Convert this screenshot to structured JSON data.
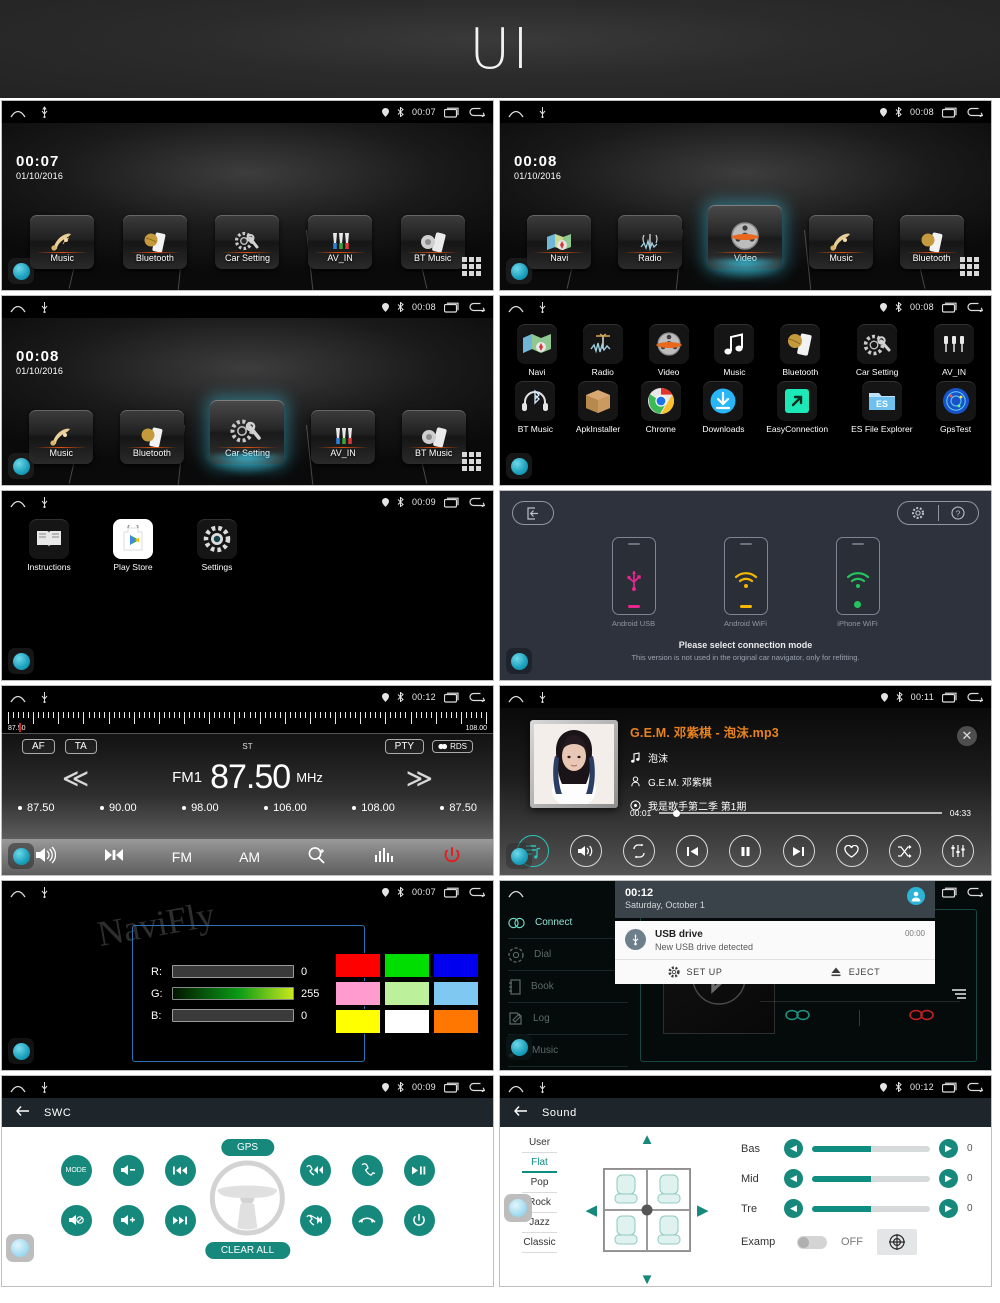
{
  "header": {
    "title": "UI"
  },
  "statusbar": {
    "home_icon": "home-icon",
    "usb_icon": "usb-icon",
    "gps_icon": "gps-pin-icon",
    "bt_icon": "bluetooth-icon",
    "recents_icon": "recents-icon",
    "back_icon": "back-icon"
  },
  "screens": {
    "home1": {
      "time": "00:07",
      "status_time": "00:07",
      "date": "01/10/2016",
      "tiles": [
        {
          "label": "Music",
          "icon": "music-notes-icon"
        },
        {
          "label": "Bluetooth",
          "icon": "phone-bluetooth-icon"
        },
        {
          "label": "Car Setting",
          "icon": "gear-wrench-icon"
        },
        {
          "label": "AV_IN",
          "icon": "rca-cables-icon"
        },
        {
          "label": "BT Music",
          "icon": "speaker-phone-icon"
        }
      ]
    },
    "home2": {
      "time": "00:08",
      "status_time": "00:08",
      "date": "01/10/2016",
      "selected": "Video",
      "tiles": [
        {
          "label": "Navi",
          "icon": "map-compass-icon"
        },
        {
          "label": "Radio",
          "icon": "radio-tower-icon"
        },
        {
          "label": "Video",
          "icon": "film-reel-icon"
        },
        {
          "label": "Music",
          "icon": "music-notes-icon"
        },
        {
          "label": "Bluetooth",
          "icon": "phone-bluetooth-icon"
        }
      ]
    },
    "home3": {
      "time": "00:08",
      "status_time": "00:08",
      "date": "01/10/2016",
      "selected": "Car Setting",
      "tiles": [
        {
          "label": "Music",
          "icon": "music-notes-icon"
        },
        {
          "label": "Bluetooth",
          "icon": "phone-bluetooth-icon"
        },
        {
          "label": "Car Setting",
          "icon": "gear-wrench-icon"
        },
        {
          "label": "AV_IN",
          "icon": "rca-cables-icon"
        },
        {
          "label": "BT Music",
          "icon": "speaker-phone-icon"
        }
      ]
    },
    "drawer1": {
      "status_time": "00:08",
      "row1": [
        {
          "label": "Navi",
          "icon": "map-compass-icon"
        },
        {
          "label": "Radio",
          "icon": "radio-tower-icon"
        },
        {
          "label": "Video",
          "icon": "film-reel-icon"
        },
        {
          "label": "Music",
          "icon": "music-note-icon"
        },
        {
          "label": "Bluetooth",
          "icon": "phone-bluetooth-icon"
        },
        {
          "label": "Car Setting",
          "icon": "gear-wrench-icon"
        },
        {
          "label": "AV_IN",
          "icon": "rca-cables-icon"
        }
      ],
      "row2": [
        {
          "label": "BT Music",
          "icon": "headphone-bluetooth-icon"
        },
        {
          "label": "ApkInstaller",
          "icon": "package-box-icon"
        },
        {
          "label": "Chrome",
          "icon": "chrome-icon"
        },
        {
          "label": "Downloads",
          "icon": "download-icon"
        },
        {
          "label": "EasyConnection",
          "icon": "link-arrow-icon"
        },
        {
          "label": "ES File Explorer",
          "icon": "folder-es-icon"
        },
        {
          "label": "GpsTest",
          "icon": "gps-radar-icon"
        }
      ]
    },
    "drawer2": {
      "status_time": "00:09",
      "apps": [
        {
          "label": "Instructions",
          "icon": "book-icon"
        },
        {
          "label": "Play Store",
          "icon": "play-store-icon"
        },
        {
          "label": "Settings",
          "icon": "gear-icon"
        }
      ]
    },
    "easyconnection": {
      "exit_icon": "exit-icon",
      "settings_icon": "gear-icon",
      "help_icon": "help-icon",
      "modes": [
        {
          "label": "Android USB",
          "icon": "usb-icon",
          "color": "#e8268f"
        },
        {
          "label": "Android WiFi",
          "icon": "wifi-icon",
          "color": "#f5b700"
        },
        {
          "label": "iPhone WiFi",
          "icon": "wifi-icon",
          "color": "#22c55e"
        }
      ],
      "prompt": "Please select connection mode",
      "note": "This version is not used in the original car navigator, only for refitting."
    },
    "radio": {
      "status_time": "00:12",
      "scale_low": "87.50",
      "scale_high": "108.00",
      "af": "AF",
      "ta": "TA",
      "st": "ST",
      "pty": "PTY",
      "rds": "RDS",
      "band": "FM1",
      "frequency": "87.50",
      "unit": "MHz",
      "presets": [
        "87.50",
        "90.00",
        "98.00",
        "106.00",
        "108.00",
        "87.50"
      ],
      "bar": [
        {
          "label": "",
          "icon": "volume-icon"
        },
        {
          "label": "",
          "icon": "balance-icon"
        },
        {
          "label": "FM",
          "icon": "fm-label"
        },
        {
          "label": "AM",
          "icon": "am-label"
        },
        {
          "label": "",
          "icon": "search-plus-icon"
        },
        {
          "label": "",
          "icon": "equalizer-icon"
        },
        {
          "label": "",
          "icon": "power-icon"
        }
      ]
    },
    "music": {
      "status_time": "00:11",
      "title": "G.E.M. 邓紫棋 - 泡沫.mp3",
      "song": "泡沫",
      "artist": "G.E.M. 邓紫棋",
      "album": "我是歌手第二季 第1期",
      "elapsed": "00:01",
      "duration": "04:33",
      "controls": [
        {
          "icon": "playlist-icon",
          "active": true
        },
        {
          "icon": "volume-icon",
          "active": false
        },
        {
          "icon": "repeat-icon",
          "active": false
        },
        {
          "icon": "previous-icon",
          "active": false
        },
        {
          "icon": "pause-icon",
          "active": false
        },
        {
          "icon": "next-icon",
          "active": false
        },
        {
          "icon": "heart-icon",
          "active": false
        },
        {
          "icon": "shuffle-icon",
          "active": false
        },
        {
          "icon": "equalizer-icon",
          "active": false
        }
      ]
    },
    "colorpicker": {
      "status_time": "00:07",
      "watermark": "NaviFly",
      "channels": [
        {
          "label": "R:",
          "value": "0"
        },
        {
          "label": "G:",
          "value": "255"
        },
        {
          "label": "B:",
          "value": "0"
        }
      ],
      "swatches": [
        "#ff0000",
        "#00dd00",
        "#0000ee",
        "#ff9bce",
        "#bdf09a",
        "#7ec8f2",
        "#ffff00",
        "#ffffff",
        "#ff7700"
      ]
    },
    "bluetooth": {
      "sidebar": [
        {
          "label": "Connect",
          "icon": "link-icon",
          "active": true
        },
        {
          "label": "Dial",
          "icon": "dialpad-icon",
          "active": false
        },
        {
          "label": "Book",
          "icon": "contacts-book-icon",
          "active": false
        },
        {
          "label": "Log",
          "icon": "call-log-icon",
          "active": false
        },
        {
          "label": "Music",
          "icon": "music-note-icon",
          "active": false
        }
      ],
      "notification": {
        "time": "00:12",
        "date": "Saturday, October 1",
        "app_time": "00:00",
        "title": "USB drive",
        "subtitle": "New USB drive detected",
        "actions": [
          {
            "label": "SET UP",
            "icon": "gear-icon"
          },
          {
            "label": "EJECT",
            "icon": "eject-icon"
          }
        ]
      }
    },
    "swc": {
      "status_time": "00:09",
      "title": "SWC",
      "back_icon": "back-arrow-icon",
      "gps_label": "GPS",
      "clear_label": "CLEAR ALL",
      "left_buttons": [
        {
          "label": "MODE",
          "icon": "mode-icon"
        },
        {
          "label": "",
          "icon": "volume-down-icon"
        },
        {
          "label": "",
          "icon": "previous-track-icon"
        },
        {
          "label": "",
          "icon": "mute-icon"
        },
        {
          "label": "",
          "icon": "volume-up-icon"
        },
        {
          "label": "",
          "icon": "next-track-icon"
        }
      ],
      "right_buttons": [
        {
          "label": "",
          "icon": "call-previous-icon"
        },
        {
          "label": "",
          "icon": "call-answer-icon"
        },
        {
          "label": "",
          "icon": "play-pause-icon"
        },
        {
          "label": "",
          "icon": "call-next-icon"
        },
        {
          "label": "",
          "icon": "call-end-icon"
        },
        {
          "label": "",
          "icon": "power-icon"
        }
      ]
    },
    "sound": {
      "status_time": "00:12",
      "title": "Sound",
      "back_icon": "back-arrow-icon",
      "presets": [
        "User",
        "Flat",
        "Pop",
        "Rock",
        "Jazz",
        "Classic"
      ],
      "selected_preset": "Flat",
      "sliders": [
        {
          "label": "Bas",
          "value": "0",
          "fill_pct": 50
        },
        {
          "label": "Mid",
          "value": "0",
          "fill_pct": 50
        },
        {
          "label": "Tre",
          "value": "0",
          "fill_pct": 50
        }
      ],
      "amp": {
        "label": "Examp",
        "state": "OFF",
        "icon": "target-icon"
      },
      "accent": "#0f8d80"
    }
  }
}
